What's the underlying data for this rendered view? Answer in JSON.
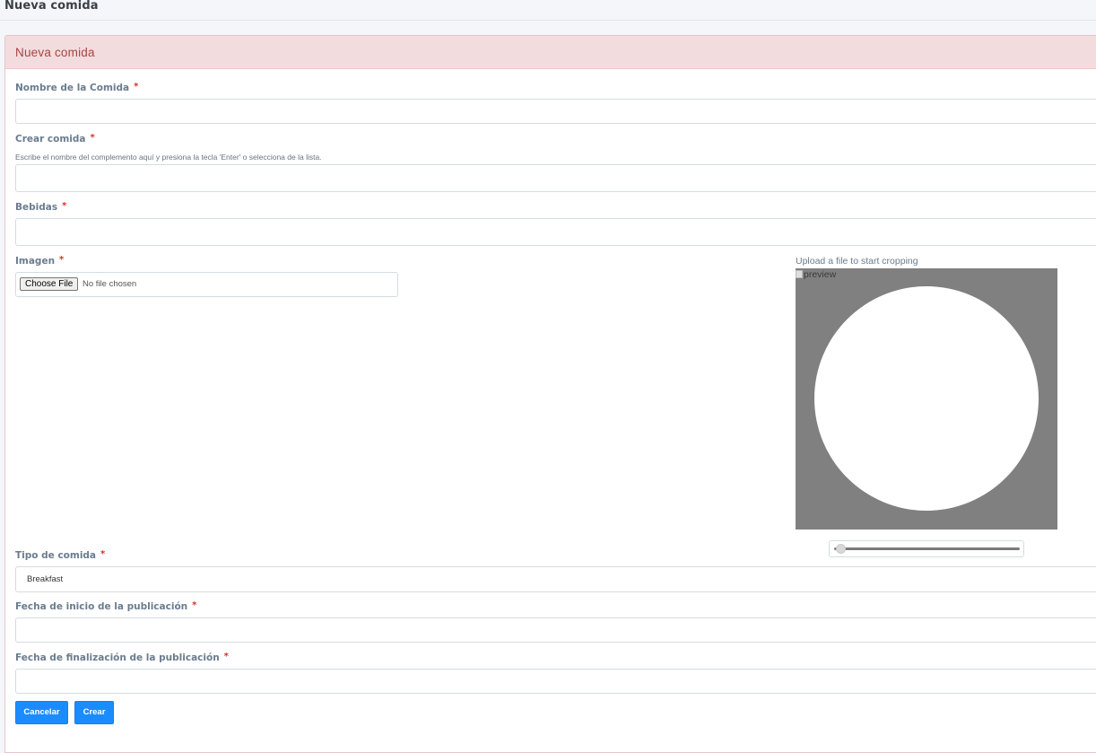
{
  "page": {
    "title": "Nueva comida"
  },
  "card": {
    "title": "Nueva comida"
  },
  "form": {
    "required_marker": "*",
    "nombre": {
      "label": "Nombre de la Comida",
      "value": ""
    },
    "crear_comida": {
      "label": "Crear comida",
      "helper": "Escribe el nombre del complemento aquí y presiona la tecla 'Enter' o selecciona de la lista.",
      "value": ""
    },
    "bebidas": {
      "label": "Bebidas",
      "value": ""
    },
    "imagen": {
      "label": "Imagen",
      "choose_button": "Choose File",
      "status": "No file chosen"
    },
    "cropper": {
      "caption": "Upload a file to start cropping",
      "preview_alt": "preview",
      "zoom_level": 0
    },
    "tipo": {
      "label": "Tipo de comida",
      "selected": "Breakfast"
    },
    "fecha_inicio": {
      "label": "Fecha de inicio de la publicación",
      "value": ""
    },
    "fecha_fin": {
      "label": "Fecha de finalización de la publicación",
      "value": ""
    }
  },
  "actions": {
    "cancel_label": "Cancelar",
    "create_label": "Crear"
  },
  "colors": {
    "primary": "#1a8cff",
    "card_header_bg": "#f3dcde",
    "card_header_text": "#a94442",
    "required": "#d9302c",
    "crop_bg": "#808080"
  }
}
